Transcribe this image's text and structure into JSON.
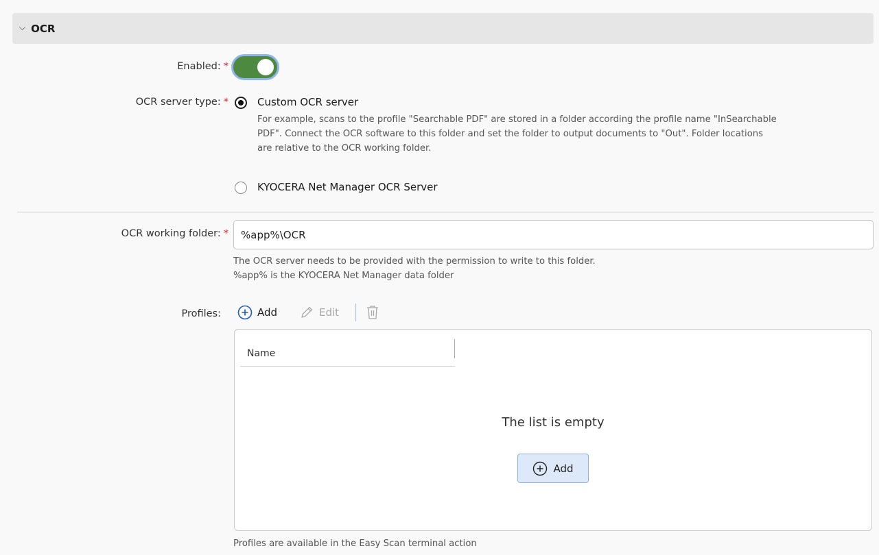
{
  "section": {
    "title": "OCR",
    "expanded": true
  },
  "enabled": {
    "label": "Enabled:",
    "required_mark": "*",
    "value": true
  },
  "server_type": {
    "label": "OCR server type:",
    "required_mark": "*",
    "options": [
      {
        "label": "Custom OCR server",
        "selected": true,
        "hint_lines": [
          "For example, scans to the profile \"Searchable PDF\" are stored in a folder according the profile name \"InSearchable",
          "PDF\". Connect the OCR software to this folder and set the folder to output documents to \"Out\". Folder locations",
          "are relative to the OCR working folder."
        ]
      },
      {
        "label": "KYOCERA Net Manager OCR Server",
        "selected": false
      }
    ]
  },
  "working_folder": {
    "label": "OCR working folder:",
    "required_mark": "*",
    "value": "%app%\\OCR",
    "hint_lines": [
      "The OCR server needs to be provided with the permission to write to this folder.",
      "%app% is the KYOCERA Net Manager data folder"
    ]
  },
  "profiles": {
    "label": "Profiles:",
    "toolbar": {
      "add": "Add",
      "edit": "Edit",
      "delete_icon": "trash-icon"
    },
    "table": {
      "columns": [
        "Name"
      ],
      "rows": [],
      "empty_message": "The list is empty",
      "add_button": "Add"
    },
    "footer_note": "Profiles are available in the Easy Scan terminal action"
  },
  "colors": {
    "toggle_on": "#4d8a3f",
    "toggle_focus": "#8fb6ea",
    "required": "#c4262e",
    "accent_blue": "#1f5bb8",
    "button_bg": "#dde8f8"
  }
}
